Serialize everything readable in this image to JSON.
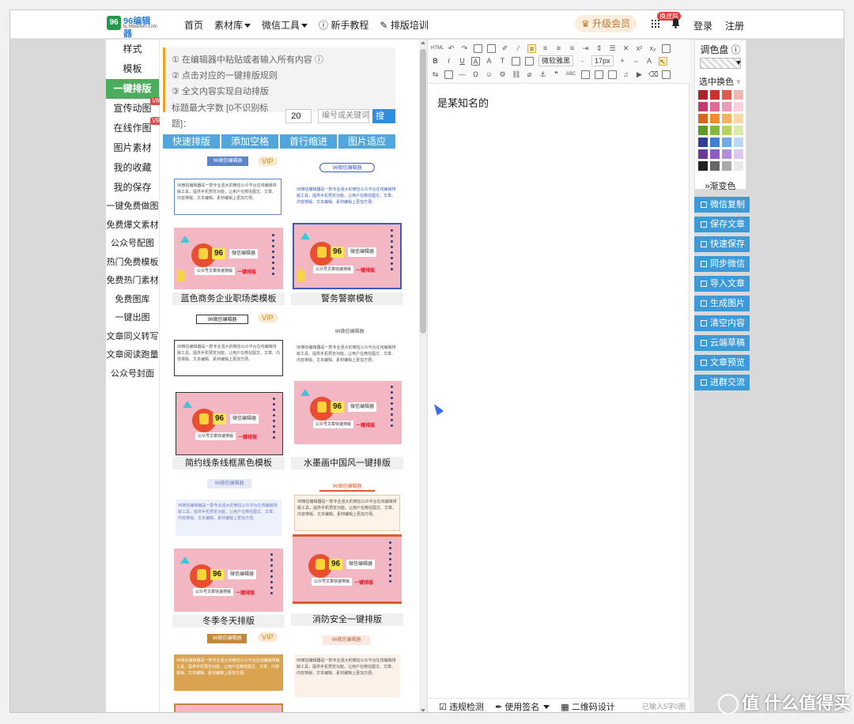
{
  "header": {
    "logo_name": "96编辑器",
    "logo_sub": "bj.96weixin.com",
    "nav": [
      "首页",
      "素材库",
      "微信工具",
      "新手教程",
      "排版培训"
    ],
    "upgrade": "升级会员",
    "badge": "换皮肤",
    "login": "登录",
    "register": "注册"
  },
  "leftnav": {
    "items": [
      {
        "label": "样式"
      },
      {
        "label": "模板"
      },
      {
        "label": "一键排版"
      },
      {
        "label": "宣传动图",
        "vip": "VIP"
      },
      {
        "label": "在线作图",
        "vip": "VIP"
      },
      {
        "label": "图片素材"
      },
      {
        "label": "我的收藏"
      },
      {
        "label": "我的保存"
      },
      {
        "label": "一键免费做图"
      },
      {
        "label": "免费爆文素材"
      },
      {
        "label": "公众号配图"
      },
      {
        "label": "热门免费模板"
      },
      {
        "label": "免费热门素材"
      },
      {
        "label": "免费图库"
      },
      {
        "label": "一键出图"
      },
      {
        "label": "文章同义转写"
      },
      {
        "label": "文章阅读跑量"
      },
      {
        "label": "公众号封面"
      }
    ]
  },
  "notice": {
    "line1": "① 在编辑器中粘贴或者输入所有内容 ⓘ",
    "line2": "② 点击对应的一键排版规则",
    "line3": "③ 全文内容实现自动排版",
    "max_label": "标题最大字数 [0不识别标题]：",
    "max_value": "20",
    "keyword_placeholder": "编号或关键词",
    "search": "搜索"
  },
  "actions": [
    "快速排版",
    "添加空格",
    "首行缩进",
    "图片适应"
  ],
  "templates": {
    "header_chip": "96微信编辑器",
    "vip": "VIP",
    "body_text": "96微信编辑器是一款专业强大的微信公众平台在线编辑排版工具，提供手机预览功能，让用户在微信图文、文章、内容排版、文本编辑、素材编辑上更加方便。",
    "poster_num": "96",
    "poster_name": "微信编辑器",
    "poster_tag": "公众号文章快速排版",
    "poster_red": "一键排版",
    "label_1": "蓝色商务企业职场类模板",
    "label_2": "警务警察模板",
    "label_3": "简约线条线框黑色模板",
    "label_4": "水墨画中国风一键排版",
    "label_5": "冬季冬天排版",
    "label_6": "消防安全一键排版"
  },
  "editor": {
    "toolbar": {
      "font": "微软雅黑",
      "size": "17px"
    },
    "content": "是某知名的",
    "bottom": [
      "违规检测",
      "使用签名",
      "二维码设计"
    ],
    "count": "已输入5字0图"
  },
  "palette": {
    "title": "调色盘 ⓘ",
    "swap": "选中换色",
    "gradient": "渐变色",
    "colors": [
      "#a8262a",
      "#c7312f",
      "#e05a4b",
      "#f2b6b0",
      "#c33a6e",
      "#e06b94",
      "#ef9ab7",
      "#f8cfdc",
      "#d9661f",
      "#ef8d2e",
      "#f6b25a",
      "#fad8a8",
      "#5c9a2b",
      "#86b93a",
      "#b9d35c",
      "#dbe9aa",
      "#2f3f9a",
      "#3f7fd6",
      "#6ea9ea",
      "#b7d9f5",
      "#6a3896",
      "#8d5bc0",
      "#b48ddb",
      "#ddc9ef",
      "#222222",
      "#666666",
      "#a9a9a9",
      "#e9e9e9"
    ]
  },
  "side_buttons": [
    "微信复制",
    "保存文章",
    "快速保存",
    "同步微信",
    "导入文章",
    "生成图片",
    "清空内容",
    "云端草稿",
    "文章预览",
    "进群交流"
  ],
  "watermark": "值 什么值得买"
}
